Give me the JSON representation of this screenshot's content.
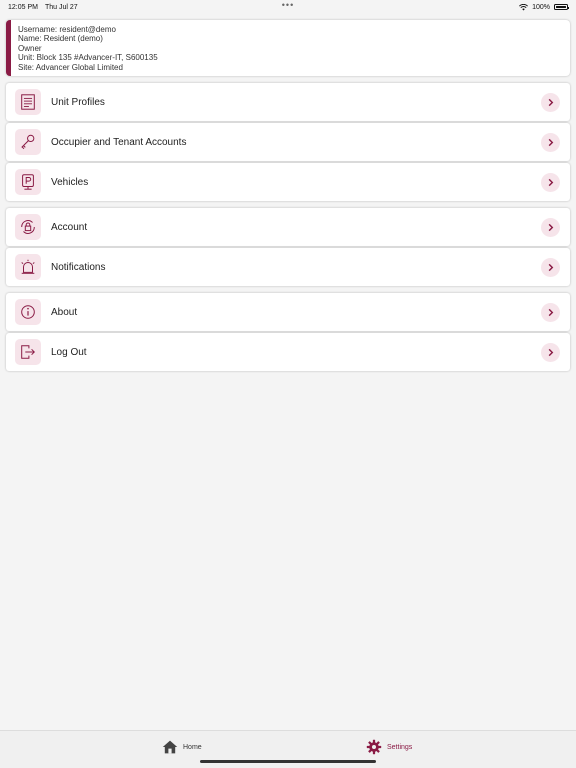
{
  "status_bar": {
    "time": "12:05 PM",
    "date": "Thu Jul 27",
    "dots": "•••",
    "battery": "100%",
    "battery_level": 1.0
  },
  "user": {
    "username": "Username: resident@demo",
    "name": "Name: Resident (demo)",
    "role": "Owner",
    "unit": "Unit: Block 135 #Advancer-IT, S600135",
    "site": "Site: Advancer Global Limited"
  },
  "menu_groups": [
    [
      {
        "label": "Unit Profiles",
        "icon": "document-icon"
      },
      {
        "label": "Occupier and Tenant Accounts",
        "icon": "key-icon"
      },
      {
        "label": "Vehicles",
        "icon": "parking-icon"
      }
    ],
    [
      {
        "label": "Account",
        "icon": "lock-icon"
      },
      {
        "label": "Notifications",
        "icon": "alarm-icon"
      }
    ],
    [
      {
        "label": "About",
        "icon": "info-icon"
      },
      {
        "label": "Log Out",
        "icon": "logout-icon"
      }
    ]
  ],
  "tabs": {
    "home": "Home",
    "settings": "Settings"
  },
  "colors": {
    "accent": "#8a1b45",
    "icon_bg": "#f6e4ea",
    "background": "#f4f4f4"
  }
}
